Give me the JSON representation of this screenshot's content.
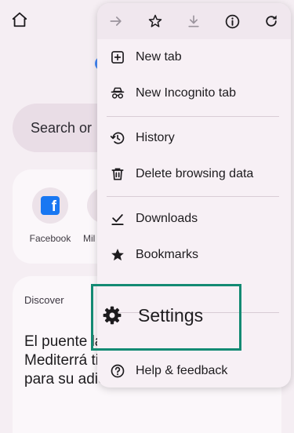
{
  "background": {
    "search_placeholder": "Search or",
    "shortcuts": [
      {
        "label": "Facebook"
      },
      {
        "label": "Mil"
      }
    ],
    "discover": {
      "title": "Discover",
      "headline": "El puente la avenida Mediterrá tiene fecha para su adiós"
    }
  },
  "menu": {
    "toolbar": [
      "forward-arrow-icon",
      "star-icon",
      "download-icon",
      "info-icon",
      "refresh-icon"
    ],
    "items": {
      "new_tab": "New tab",
      "new_incognito_tab": "New Incognito tab",
      "history": "History",
      "delete_browsing_data": "Delete browsing data",
      "downloads": "Downloads",
      "bookmarks": "Bookmarks",
      "settings": "Settings",
      "help_feedback": "Help & feedback"
    }
  },
  "colors": {
    "page_background": "#f5eef3",
    "menu_background": "#f7f0f5",
    "highlight": "#138a73",
    "facebook_blue": "#1877f2"
  }
}
